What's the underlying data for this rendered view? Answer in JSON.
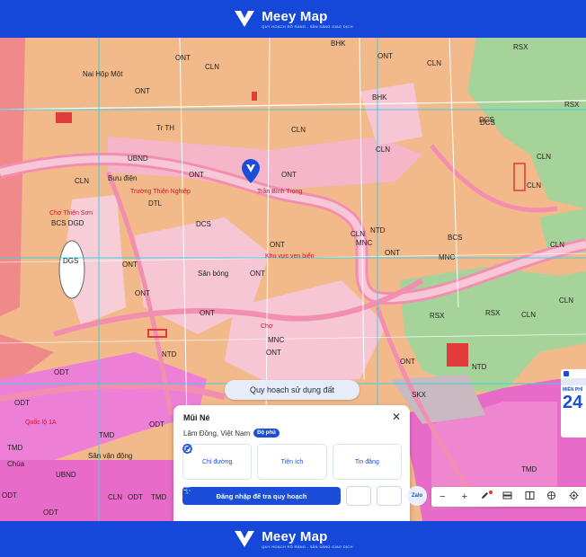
{
  "brand": {
    "name": "Meey Map",
    "tagline": "QUY HOẠCH RÕ RÀNG - SẴN SÀNG GIAO DỊCH"
  },
  "map": {
    "labels_black": [
      "BHK",
      "RSX",
      "ONT",
      "CLN",
      "CLN",
      "ONT",
      "BHK",
      "RSX",
      "Nai Hộp Một",
      "ONT",
      "Tr TH",
      "CLN",
      "DCS",
      "CLN",
      "UBND",
      "Bưu điện",
      "CLN",
      "ONT",
      "ONT",
      "CLN",
      "CLN",
      "DTL",
      "BCS DGD",
      "DCS",
      "ONT",
      "MNC",
      "CLN",
      "ONT",
      "ONT",
      "NTD",
      "DCS",
      "MNC",
      "BCS",
      "CLN",
      "ONT",
      "DGS",
      "ONT",
      "Sân bóng",
      "ONT",
      "RSX",
      "RSX",
      "CLN",
      "CLN",
      "NTD",
      "ONT",
      "ONT",
      "ODT",
      "MNC",
      "NTD",
      "ODT",
      "SKX",
      "ODT",
      "TMD",
      "TMD",
      "UBND",
      "TMD",
      "Sân vận động",
      "Chùa",
      "ODT",
      "CLN",
      "ODT",
      "TMD",
      "ODT"
    ],
    "labels_red": [
      "Chợ Thiện Sơn",
      "Trần Bình Trọng",
      "Trường Thiện Nghiệp",
      "Khu vực ven biển",
      "Quốc lộ 1A",
      "Chợ"
    ]
  },
  "chip": {
    "label": "Quy hoạch sử dụng đất"
  },
  "panel": {
    "title": "Mũi Né",
    "location": "Lâm Đồng, Việt Nam",
    "badge": "Độ phủ",
    "actions": [
      {
        "label": "Chỉ đường",
        "icon": "directions-icon"
      },
      {
        "label": "Tiện ích",
        "icon": "utilities-icon"
      },
      {
        "label": "Tin đăng",
        "icon": "listing-icon"
      }
    ],
    "login_label": "Đăng nhập để tra quy hoạch"
  },
  "zalo": {
    "label": "Zalo"
  },
  "toolbar": {
    "minus": "−",
    "plus": "+"
  },
  "minicard": {
    "label": "MIỄN PHÍ",
    "number": "24"
  },
  "colors": {
    "brand": "#1548d8",
    "accent": "#1a4ed8",
    "map_base": "#f2b98a",
    "road": "#f4b6c8",
    "forest": "#a6d39a",
    "commercial": "#e86bc9"
  }
}
